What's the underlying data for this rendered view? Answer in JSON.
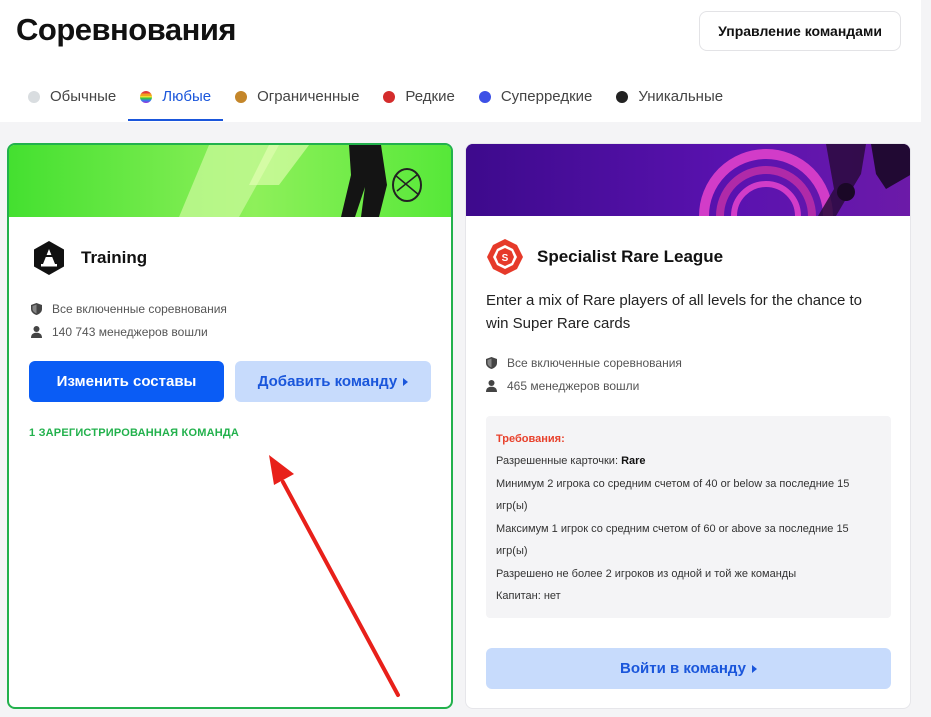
{
  "header": {
    "title": "Соревнования",
    "manage_button": "Управление командами"
  },
  "tabs": [
    {
      "label": "Обычные",
      "color": "#d9dde0",
      "active": false
    },
    {
      "label": "Любые",
      "color": "rainbow",
      "active": true
    },
    {
      "label": "Ограниченные",
      "color": "#c4862a",
      "active": false
    },
    {
      "label": "Редкие",
      "color": "#d42c2c",
      "active": false
    },
    {
      "label": "Суперредкие",
      "color": "#3c50e6",
      "active": false
    },
    {
      "label": "Уникальные",
      "color": "#222222",
      "active": false
    }
  ],
  "cards": [
    {
      "name": "Training",
      "icon": "cone-badge-icon",
      "meta_scope": "Все включенные соревнования",
      "meta_managers": "140 743 менеджеров вошли",
      "btn_edit": "Изменить составы",
      "btn_add": "Добавить команду",
      "registered": "1 ЗАРЕГИСТРИРОВАННАЯ КОМАНДА"
    },
    {
      "name": "Specialist Rare League",
      "icon": "rare-league-badge-icon",
      "description": "Enter a mix of Rare players of all levels for the chance to win Super Rare cards",
      "meta_scope": "Все включенные соревнования",
      "meta_managers": "465 менеджеров вошли",
      "requirements": {
        "title": "Требования:",
        "allowed_prefix": "Разрешенные карточки: ",
        "allowed_value": "Rare",
        "line1": "Минимум 2 игрока со средним счетом of 40 or below за последние 15 игр(ы)",
        "line2": "Максимум 1 игрок со средним счетом of 60 or above за последние 15 игр(ы)",
        "line3": "Разрешено не более 2 игроков из одной и той же команды",
        "line4": "Капитан: нет"
      },
      "btn_join": "Войти в команду"
    }
  ],
  "colors": {
    "primary": "#0a5cf5",
    "success": "#22b14c",
    "danger": "#e8412c",
    "annotation_arrow": "#e8201a"
  }
}
